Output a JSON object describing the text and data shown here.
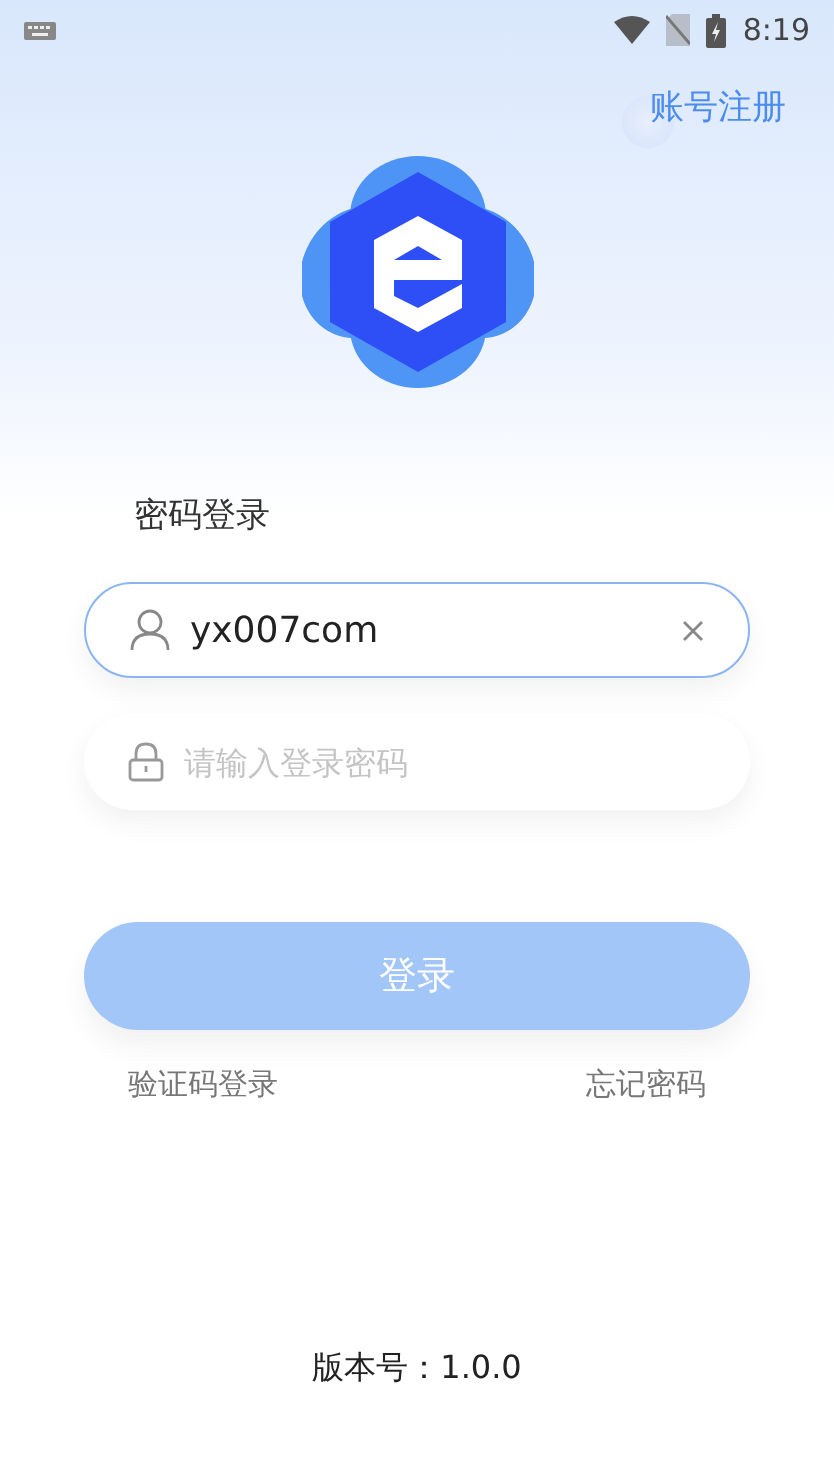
{
  "status_bar": {
    "time": "8:19"
  },
  "register_link": "账号注册",
  "title": "密码登录",
  "username": {
    "value": "yx007com",
    "focused": true
  },
  "password": {
    "placeholder": "请输入登录密码"
  },
  "login_button": {
    "label": "登录",
    "disabled": true
  },
  "links": [
    {
      "label": "验证码登录"
    },
    {
      "label": "忘记密码"
    }
  ],
  "version": "版本号：1.0.0"
}
